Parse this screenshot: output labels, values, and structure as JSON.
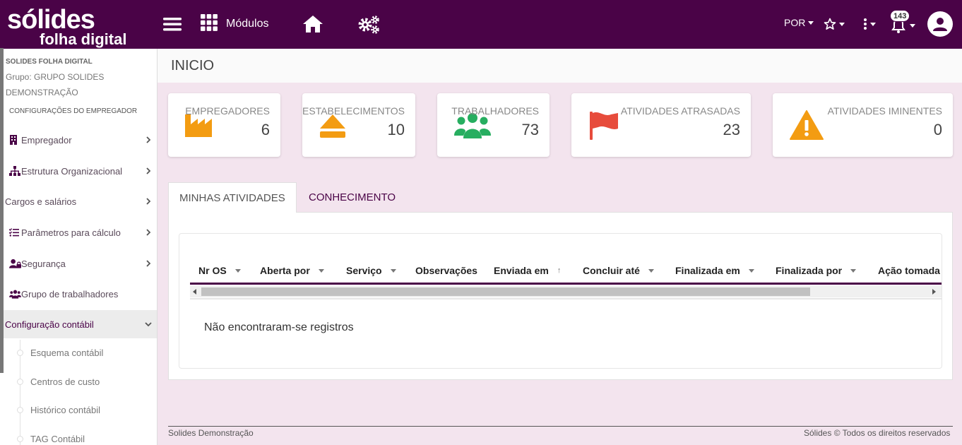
{
  "header": {
    "logo_main": "sólides",
    "logo_sub": "folha digital",
    "modules_label": "Módulos",
    "language": "POR",
    "notifications_count": "143"
  },
  "sidebar": {
    "company": "SOLIDES FOLHA DIGITAL",
    "group": "Grupo: GRUPO SOLIDES DEMONSTRAÇÃO",
    "section": "CONFIGURAÇÕES DO EMPREGADOR",
    "items": [
      {
        "label": "Empregador",
        "icon": "building-icon"
      },
      {
        "label": "Estrutura Organizacional",
        "icon": "sitemap-icon"
      },
      {
        "label": "Cargos e salários",
        "icon": ""
      },
      {
        "label": "Parâmetros para cálculo",
        "icon": "tasks-icon"
      },
      {
        "label": "Segurança",
        "icon": "user-lock-icon"
      },
      {
        "label": "Grupo de trabalhadores",
        "icon": "users-icon"
      },
      {
        "label": "Configuração contábil",
        "icon": ""
      }
    ],
    "subitems": [
      {
        "label": "Esquema contábil"
      },
      {
        "label": "Centros de custo"
      },
      {
        "label": "Histórico contábil"
      },
      {
        "label": "TAG Contábil"
      }
    ]
  },
  "page": {
    "title": "INICIO"
  },
  "cards": [
    {
      "title": "EMPREGADORES",
      "value": "6",
      "icon": "factory-icon",
      "color": "#f39c12"
    },
    {
      "title": "ESTABELECIMENTOS",
      "value": "10",
      "icon": "eject-icon",
      "color": "#f39c12"
    },
    {
      "title": "TRABALHADORES",
      "value": "73",
      "icon": "users-icon",
      "color": "#27ae60"
    },
    {
      "title": "ATIVIDADES ATRASADAS",
      "value": "23",
      "icon": "flag-icon",
      "color": "#e74c3c"
    },
    {
      "title": "ATIVIDADES IMINENTES",
      "value": "0",
      "icon": "warning-icon",
      "color": "#f39c12"
    }
  ],
  "tabs": [
    {
      "label": "MINHAS ATIVIDADES",
      "active": true
    },
    {
      "label": "CONHECIMENTO",
      "active": false
    }
  ],
  "table": {
    "columns": [
      "Nr OS",
      "Aberta por",
      "Serviço",
      "Observações",
      "Enviada em",
      "Concluir até",
      "Finalizada em",
      "Finalizada por",
      "Ação tomada"
    ],
    "empty_message": "Não encontraram-se registros"
  },
  "footer": {
    "left": "Solides Demonstração",
    "right": "Sólides © Todos os direitos reservados"
  },
  "colors": {
    "brand": "#4a0347",
    "background": "#f3e4ee"
  }
}
